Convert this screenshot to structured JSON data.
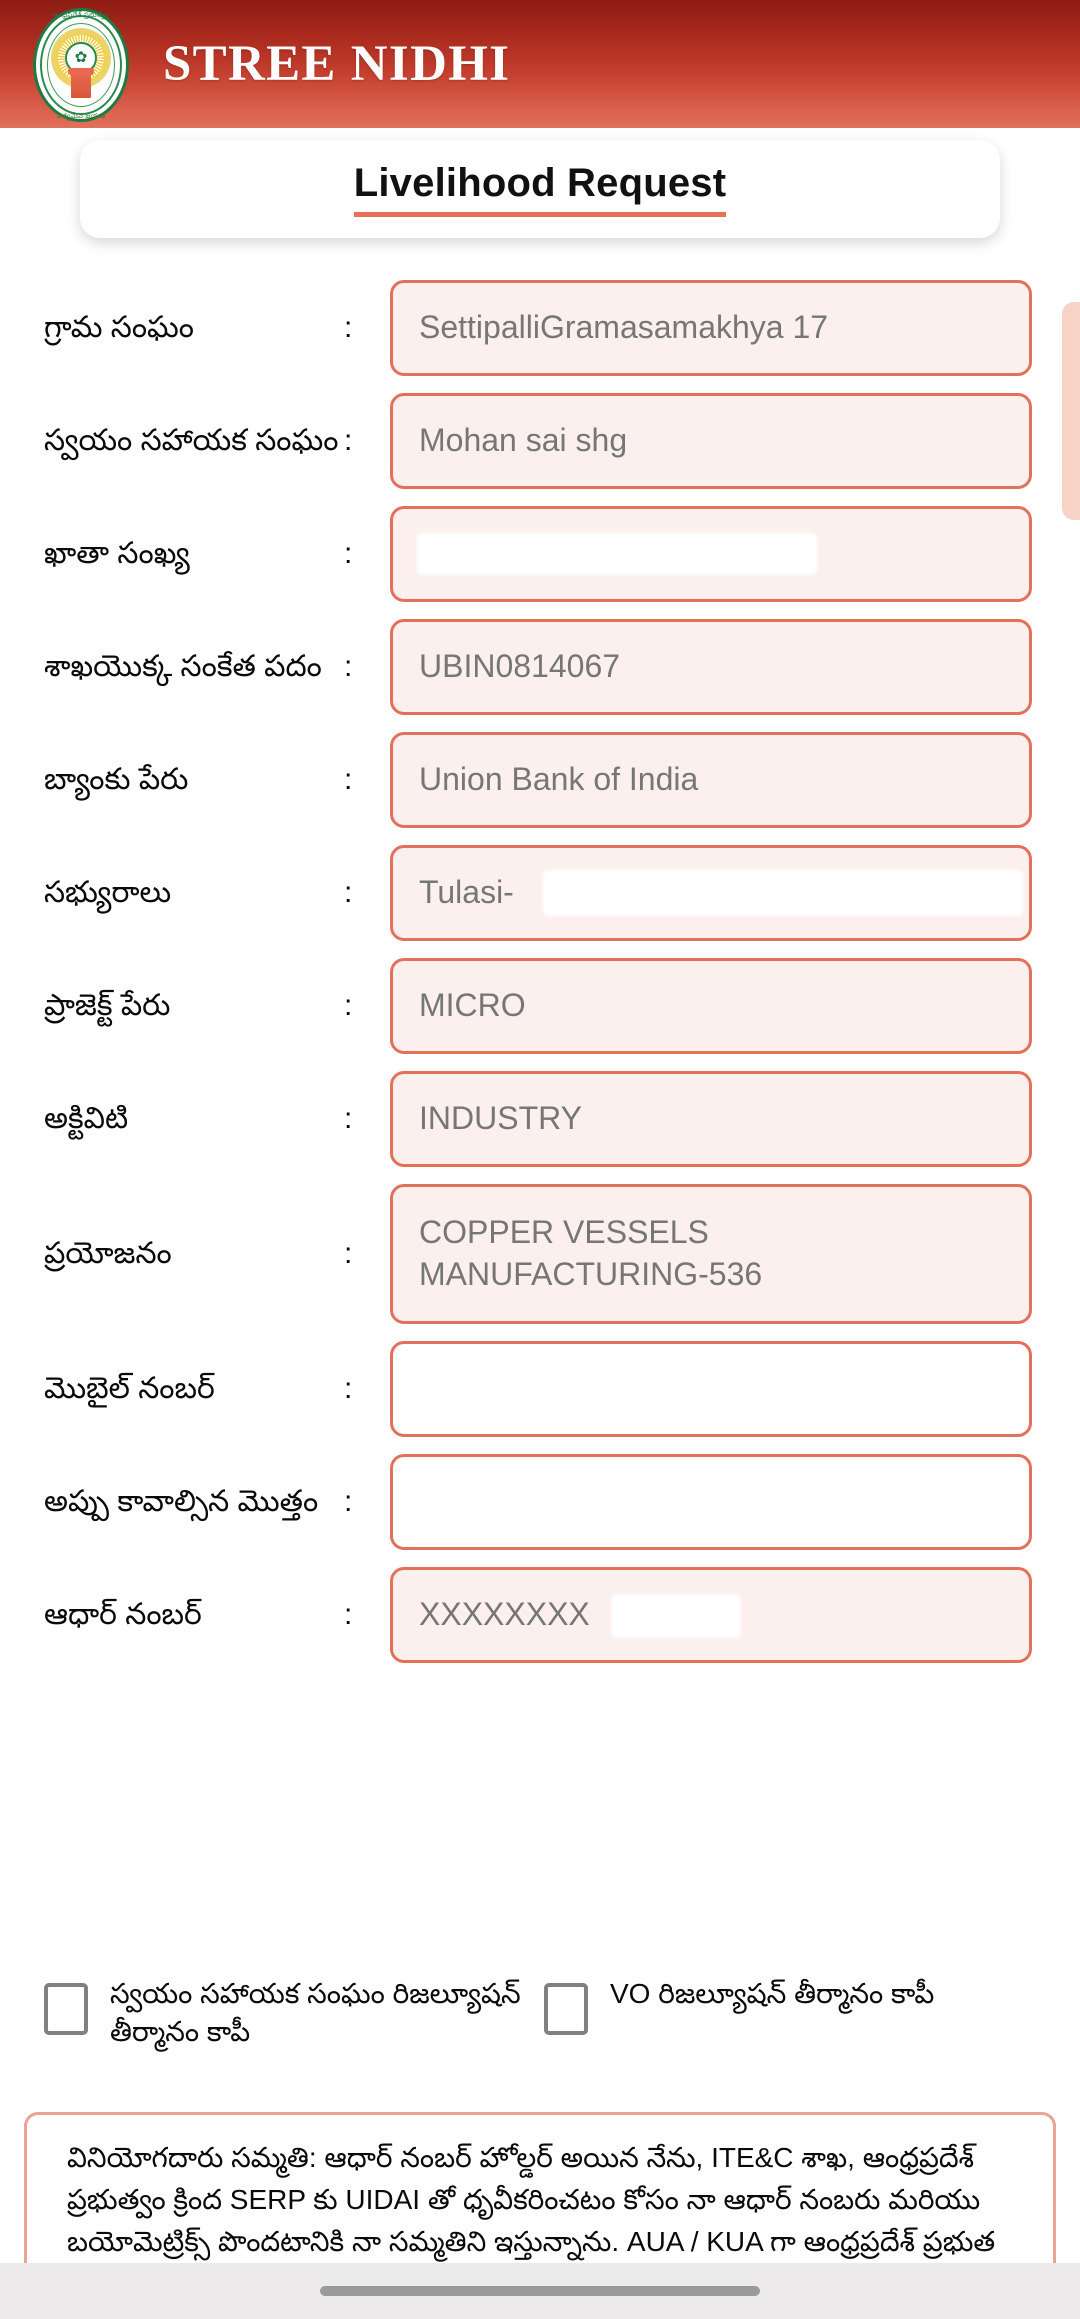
{
  "app": {
    "brand_title": "STREE NIDHI",
    "emblem_top_text": "ఆంధ్రప్రదేశ్ ప్రభుత్వం",
    "emblem_bottom_text": "సత్యమేవ జయతే",
    "emblem_center": "✿",
    "header_gradient_from": "#8d1c14",
    "header_gradient_to": "#e0705c",
    "accent_color": "#e2715c"
  },
  "card": {
    "page_title": "Livelihood Request"
  },
  "form": {
    "colon": ":",
    "rows": [
      {
        "label": "గ్రామ సంఘం",
        "value": "SettipalliGramasamakhya 17",
        "redacted": false,
        "tall": false,
        "empty": false
      },
      {
        "label": "స్వయం సహాయక సంఘం",
        "value": "Mohan sai shg",
        "redacted": false,
        "tall": false,
        "empty": false
      },
      {
        "label": "ఖాతా సంఖ్య",
        "value": "",
        "redacted": true,
        "tall": false,
        "empty": false
      },
      {
        "label": "శాఖయొక్క సంకేత పదం",
        "value": "UBIN0814067",
        "redacted": false,
        "tall": false,
        "empty": false
      },
      {
        "label": "బ్యాంకు పేరు",
        "value": "Union Bank of India",
        "redacted": false,
        "tall": false,
        "empty": false
      },
      {
        "label": "సభ్యురాలు",
        "value": "Tulasi-",
        "redacted": true,
        "tall": false,
        "empty": false
      },
      {
        "label": "ప్రాజెక్ట్ పేరు",
        "value": "MICRO",
        "redacted": false,
        "tall": false,
        "empty": false
      },
      {
        "label": "అక్టివిటి",
        "value": "INDUSTRY",
        "redacted": false,
        "tall": false,
        "empty": false
      },
      {
        "label": "ప్రయోజనం",
        "value": "COPPER VESSELS MANUFACTURING-536",
        "redacted": false,
        "tall": true,
        "empty": false
      },
      {
        "label": "మొబైల్ నంబర్",
        "value": "",
        "redacted": false,
        "tall": false,
        "empty": true
      },
      {
        "label": "అప్పు కావాల్సిన మొత్తం",
        "value": "",
        "redacted": false,
        "tall": false,
        "empty": true
      },
      {
        "label": "ఆధార్ నంబర్",
        "value": "XXXXXXXX",
        "redacted": true,
        "tall": false,
        "empty": false
      }
    ]
  },
  "checkboxes": [
    {
      "label": "స్వయం సహాయక సంఘం రిజల్యూషన్ తీర్మానం కాపీ",
      "checked": false
    },
    {
      "label": "VO రిజల్యూషన్ తీర్మానం కాపీ",
      "checked": false
    }
  ],
  "consent": {
    "text": "వినియోగదారు సమ్మతి: ఆధార్ నంబర్ హోల్డర్ అయిన నేను, ITE&C శాఖ, ఆంధ్రప్రదేశ్ ప్రభుత్వం క్రింద SERP కు UIDAI తో ధృవీకరించటం కోసం నా ఆధార్ నంబరు మరియు బయోమెట్రిక్స్ పొందటానికి నా సమ్మతిని ఇస్తున్నాను. AUA / KUA గా ఆంధ్రప్రదేశ్ ప్రభుత"
  }
}
